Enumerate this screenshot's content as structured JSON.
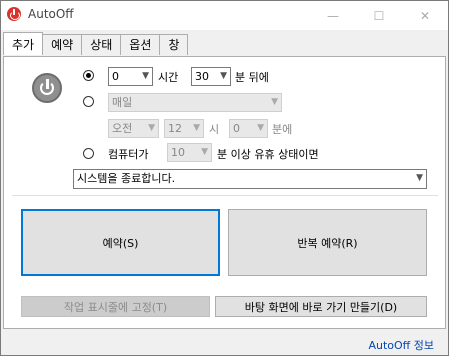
{
  "window": {
    "title": "AutoOff",
    "minimize": "—",
    "maximize": "☐",
    "close": "✕"
  },
  "tabs": [
    {
      "label": "추가",
      "active": true
    },
    {
      "label": "예약"
    },
    {
      "label": "상태"
    },
    {
      "label": "옵션"
    },
    {
      "label": "창"
    }
  ],
  "timer": {
    "hours": "0",
    "hours_unit": "시간",
    "minutes": "30",
    "minutes_unit": "분 뒤에"
  },
  "schedule": {
    "repeat": "매일",
    "ampm": "오전",
    "hour": "12",
    "hour_unit": "시",
    "minute": "0",
    "minute_unit": "분에"
  },
  "idle": {
    "prefix": "컴퓨터가",
    "minutes": "10",
    "suffix": "분 이상 유휴 상태이면"
  },
  "action": {
    "selected": "시스템을 종료합니다."
  },
  "buttons": {
    "reserve": "예약(S)",
    "repeat_reserve": "반복 예약(R)",
    "pin_taskbar": "작업 표시줄에 고정(T)",
    "desktop_shortcut": "바탕 화면에 바로 가기 만들기(D)"
  },
  "footer": {
    "about": "AutoOff 정보"
  }
}
